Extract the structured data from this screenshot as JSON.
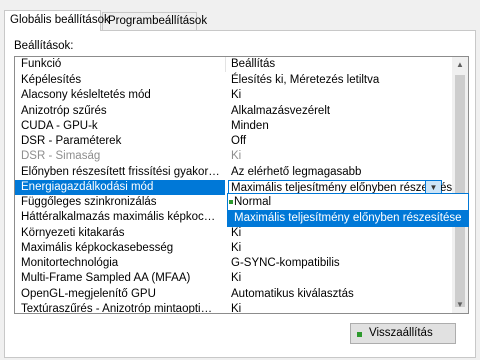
{
  "tabs": [
    {
      "label": "Globális beállítások",
      "active": true
    },
    {
      "label": "Programbeállítások",
      "active": false
    }
  ],
  "section_label": "Beállítások:",
  "grid": {
    "headers": {
      "feature": "Funkció",
      "setting": "Beállítás"
    },
    "rows": [
      {
        "feature": "Képélesítés",
        "setting": "Élesítés ki, Méretezés letiltva"
      },
      {
        "feature": "Alacsony késleltetés mód",
        "setting": "Ki"
      },
      {
        "feature": "Anizotróp szűrés",
        "setting": "Alkalmazásvezérelt"
      },
      {
        "feature": "CUDA - GPU-k",
        "setting": "Minden"
      },
      {
        "feature": "DSR - Paraméterek",
        "setting": "Off"
      },
      {
        "feature": "DSR - Simaság",
        "setting": "Ki",
        "disabled": true
      },
      {
        "feature": "Előnyben részesített frissítési gyakoriság (S...",
        "setting": "Az elérhető legmagasabb"
      },
      {
        "feature": "Energiagazdálkodási mód",
        "setting": "Maximális teljesítmény előnyben részesítése",
        "selected": true
      },
      {
        "feature": "Függőleges szinkronizálás",
        "setting": ""
      },
      {
        "feature": "Háttéralkalmazás maximális képkockasebes...",
        "setting": ""
      },
      {
        "feature": "Környezeti kitakarás",
        "setting": "Ki"
      },
      {
        "feature": "Maximális képkockasebesség",
        "setting": "Ki"
      },
      {
        "feature": "Monitortechnológia",
        "setting": "G-SYNC-kompatibilis"
      },
      {
        "feature": "Multi-Frame Sampled AA (MFAA)",
        "setting": "Ki"
      },
      {
        "feature": "OpenGL-megjelenítő GPU",
        "setting": "Automatikus kiválasztás"
      },
      {
        "feature": "Textúraszűrés - Anizotróp mintaoptimalizálás",
        "setting": "Ki"
      }
    ]
  },
  "dropdown": {
    "options": [
      "Normal",
      "Maximális teljesítmény előnyben részesítése"
    ],
    "highlighted_index": 1
  },
  "restore_button": {
    "label": "Visszaállítás"
  },
  "colors": {
    "selection": "#0078d7",
    "indicator": "#2e9a2e"
  }
}
